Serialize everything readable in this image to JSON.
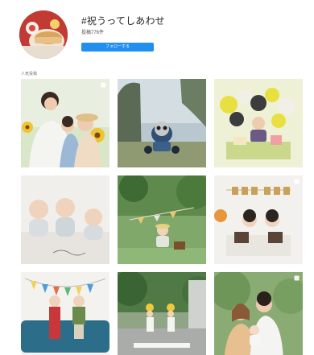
{
  "header": {
    "hashtag": "#祝うってしあわせ",
    "post_count": "投稿776件",
    "follow_label": "フォローする"
  },
  "section": {
    "label": "人気投稿"
  },
  "posts": [
    {
      "name": "post-family-sunflowers",
      "multi": true
    },
    {
      "name": "post-toy-in-forest",
      "multi": false
    },
    {
      "name": "post-birthday-balloons",
      "multi": false
    },
    {
      "name": "post-three-babies",
      "multi": false
    },
    {
      "name": "post-child-garden-picnic",
      "multi": false
    },
    {
      "name": "post-happy-birthday-girls",
      "multi": true
    },
    {
      "name": "post-birthday-bunting-kids",
      "multi": false
    },
    {
      "name": "post-children-walking-street",
      "multi": false
    },
    {
      "name": "post-couple-with-baby",
      "multi": true
    }
  ],
  "colors": {
    "accent": "#1f8ff2",
    "text": "#262626"
  },
  "icons": {
    "multi_post": "multiple-images-icon"
  }
}
